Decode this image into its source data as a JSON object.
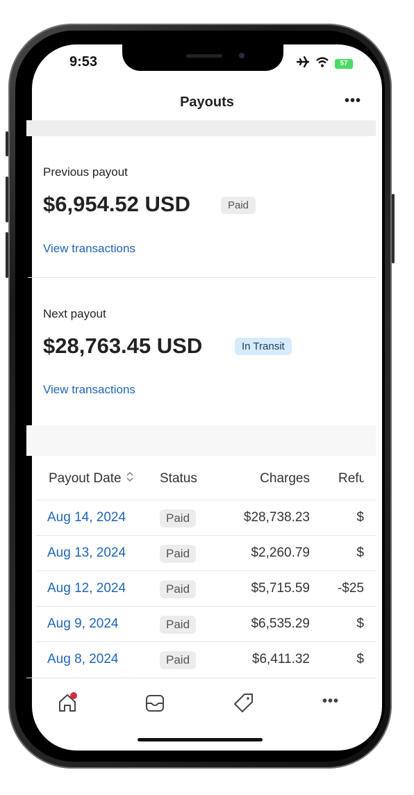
{
  "status_bar": {
    "time": "9:53",
    "battery": "57"
  },
  "header": {
    "title": "Payouts",
    "more_label": "•••"
  },
  "previous_payout": {
    "label": "Previous payout",
    "amount": "$6,954.52 USD",
    "status": "Paid",
    "link": "View transactions"
  },
  "next_payout": {
    "label": "Next payout",
    "amount": "$28,763.45 USD",
    "status": "In Transit",
    "link": "View transactions"
  },
  "table": {
    "columns": [
      "Payout Date",
      "Status",
      "Charges",
      "Refu"
    ],
    "rows": [
      {
        "date": "Aug 14, 2024",
        "status": "Paid",
        "charges": "$28,738.23",
        "refunds": "$"
      },
      {
        "date": "Aug 13, 2024",
        "status": "Paid",
        "charges": "$2,260.79",
        "refunds": "$"
      },
      {
        "date": "Aug 12, 2024",
        "status": "Paid",
        "charges": "$5,715.59",
        "refunds": "-$25"
      },
      {
        "date": "Aug 9, 2024",
        "status": "Paid",
        "charges": "$6,535.29",
        "refunds": "$"
      },
      {
        "date": "Aug 8, 2024",
        "status": "Paid",
        "charges": "$6,411.32",
        "refunds": "$"
      }
    ]
  },
  "tabbar": {
    "items": [
      "home-icon",
      "inbox-icon",
      "tag-icon",
      "more-icon"
    ],
    "more_label": "•••"
  },
  "colors": {
    "link": "#1f65b8",
    "transit_badge_bg": "#d6ebfb",
    "notification_dot": "#d62b3f"
  }
}
